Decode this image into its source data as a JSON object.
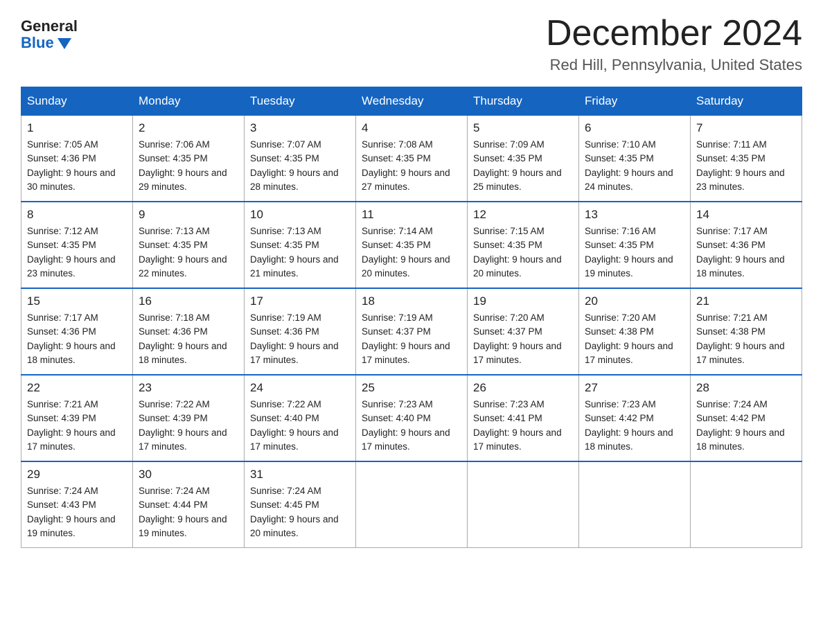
{
  "logo": {
    "general": "General",
    "blue": "Blue",
    "triangle": "▶"
  },
  "title": "December 2024",
  "location": "Red Hill, Pennsylvania, United States",
  "days_of_week": [
    "Sunday",
    "Monday",
    "Tuesday",
    "Wednesday",
    "Thursday",
    "Friday",
    "Saturday"
  ],
  "weeks": [
    [
      {
        "date": "1",
        "sunrise": "7:05 AM",
        "sunset": "4:36 PM",
        "daylight": "9 hours and 30 minutes."
      },
      {
        "date": "2",
        "sunrise": "7:06 AM",
        "sunset": "4:35 PM",
        "daylight": "9 hours and 29 minutes."
      },
      {
        "date": "3",
        "sunrise": "7:07 AM",
        "sunset": "4:35 PM",
        "daylight": "9 hours and 28 minutes."
      },
      {
        "date": "4",
        "sunrise": "7:08 AM",
        "sunset": "4:35 PM",
        "daylight": "9 hours and 27 minutes."
      },
      {
        "date": "5",
        "sunrise": "7:09 AM",
        "sunset": "4:35 PM",
        "daylight": "9 hours and 25 minutes."
      },
      {
        "date": "6",
        "sunrise": "7:10 AM",
        "sunset": "4:35 PM",
        "daylight": "9 hours and 24 minutes."
      },
      {
        "date": "7",
        "sunrise": "7:11 AM",
        "sunset": "4:35 PM",
        "daylight": "9 hours and 23 minutes."
      }
    ],
    [
      {
        "date": "8",
        "sunrise": "7:12 AM",
        "sunset": "4:35 PM",
        "daylight": "9 hours and 23 minutes."
      },
      {
        "date": "9",
        "sunrise": "7:13 AM",
        "sunset": "4:35 PM",
        "daylight": "9 hours and 22 minutes."
      },
      {
        "date": "10",
        "sunrise": "7:13 AM",
        "sunset": "4:35 PM",
        "daylight": "9 hours and 21 minutes."
      },
      {
        "date": "11",
        "sunrise": "7:14 AM",
        "sunset": "4:35 PM",
        "daylight": "9 hours and 20 minutes."
      },
      {
        "date": "12",
        "sunrise": "7:15 AM",
        "sunset": "4:35 PM",
        "daylight": "9 hours and 20 minutes."
      },
      {
        "date": "13",
        "sunrise": "7:16 AM",
        "sunset": "4:35 PM",
        "daylight": "9 hours and 19 minutes."
      },
      {
        "date": "14",
        "sunrise": "7:17 AM",
        "sunset": "4:36 PM",
        "daylight": "9 hours and 18 minutes."
      }
    ],
    [
      {
        "date": "15",
        "sunrise": "7:17 AM",
        "sunset": "4:36 PM",
        "daylight": "9 hours and 18 minutes."
      },
      {
        "date": "16",
        "sunrise": "7:18 AM",
        "sunset": "4:36 PM",
        "daylight": "9 hours and 18 minutes."
      },
      {
        "date": "17",
        "sunrise": "7:19 AM",
        "sunset": "4:36 PM",
        "daylight": "9 hours and 17 minutes."
      },
      {
        "date": "18",
        "sunrise": "7:19 AM",
        "sunset": "4:37 PM",
        "daylight": "9 hours and 17 minutes."
      },
      {
        "date": "19",
        "sunrise": "7:20 AM",
        "sunset": "4:37 PM",
        "daylight": "9 hours and 17 minutes."
      },
      {
        "date": "20",
        "sunrise": "7:20 AM",
        "sunset": "4:38 PM",
        "daylight": "9 hours and 17 minutes."
      },
      {
        "date": "21",
        "sunrise": "7:21 AM",
        "sunset": "4:38 PM",
        "daylight": "9 hours and 17 minutes."
      }
    ],
    [
      {
        "date": "22",
        "sunrise": "7:21 AM",
        "sunset": "4:39 PM",
        "daylight": "9 hours and 17 minutes."
      },
      {
        "date": "23",
        "sunrise": "7:22 AM",
        "sunset": "4:39 PM",
        "daylight": "9 hours and 17 minutes."
      },
      {
        "date": "24",
        "sunrise": "7:22 AM",
        "sunset": "4:40 PM",
        "daylight": "9 hours and 17 minutes."
      },
      {
        "date": "25",
        "sunrise": "7:23 AM",
        "sunset": "4:40 PM",
        "daylight": "9 hours and 17 minutes."
      },
      {
        "date": "26",
        "sunrise": "7:23 AM",
        "sunset": "4:41 PM",
        "daylight": "9 hours and 17 minutes."
      },
      {
        "date": "27",
        "sunrise": "7:23 AM",
        "sunset": "4:42 PM",
        "daylight": "9 hours and 18 minutes."
      },
      {
        "date": "28",
        "sunrise": "7:24 AM",
        "sunset": "4:42 PM",
        "daylight": "9 hours and 18 minutes."
      }
    ],
    [
      {
        "date": "29",
        "sunrise": "7:24 AM",
        "sunset": "4:43 PM",
        "daylight": "9 hours and 19 minutes."
      },
      {
        "date": "30",
        "sunrise": "7:24 AM",
        "sunset": "4:44 PM",
        "daylight": "9 hours and 19 minutes."
      },
      {
        "date": "31",
        "sunrise": "7:24 AM",
        "sunset": "4:45 PM",
        "daylight": "9 hours and 20 minutes."
      },
      null,
      null,
      null,
      null
    ]
  ],
  "labels": {
    "sunrise_prefix": "Sunrise: ",
    "sunset_prefix": "Sunset: ",
    "daylight_prefix": "Daylight: "
  }
}
